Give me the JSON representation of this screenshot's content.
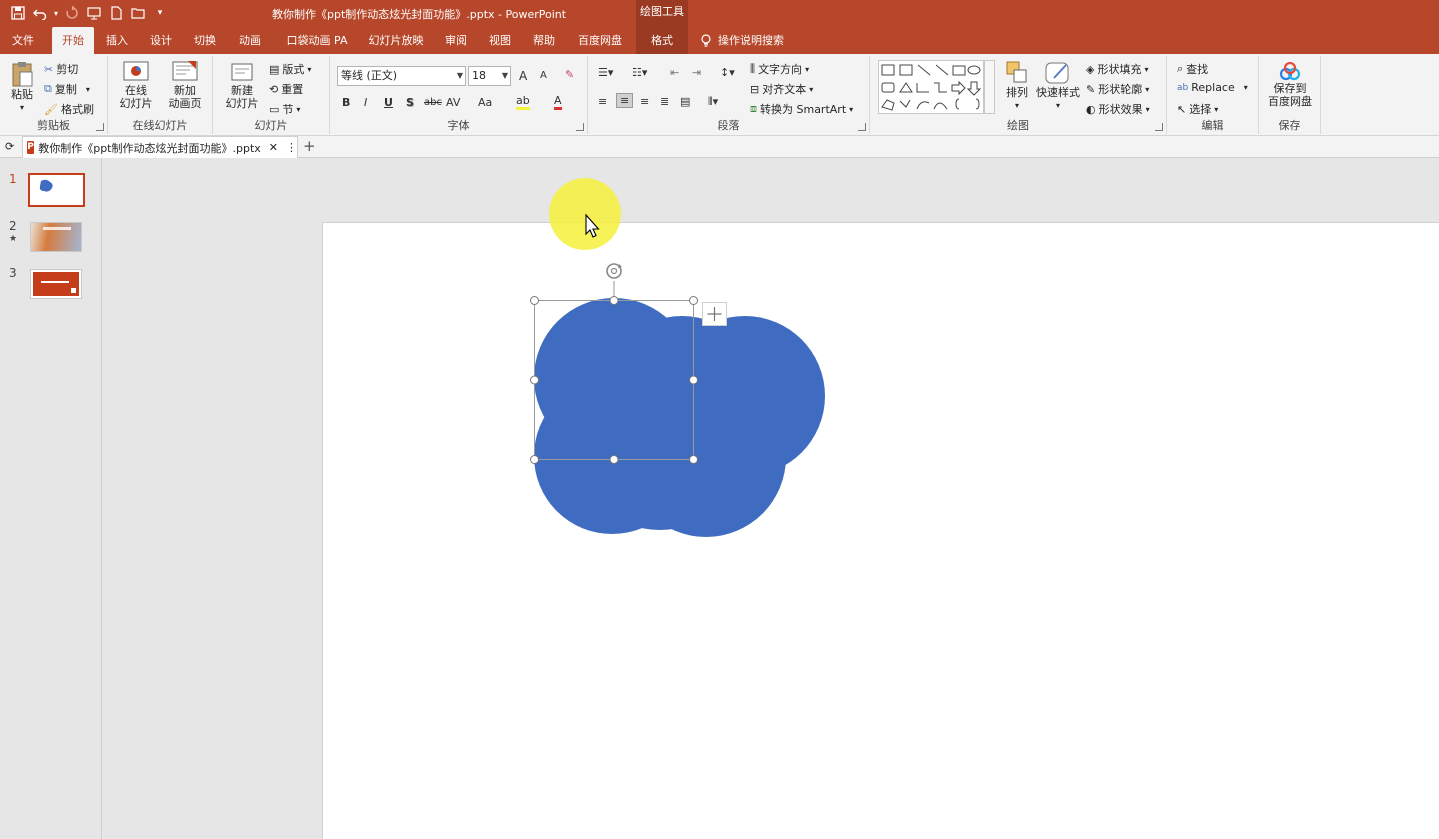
{
  "app": {
    "document_title": "教你制作《ppt制作动态炫光封面功能》.pptx  -  PowerPoint",
    "context_tool_title": "绘图工具"
  },
  "tabs": [
    "文件",
    "开始",
    "插入",
    "设计",
    "切换",
    "动画",
    "口袋动画 PA",
    "幻灯片放映",
    "审阅",
    "视图",
    "帮助",
    "百度网盘",
    "格式"
  ],
  "tell_me": "操作说明搜索",
  "ribbon": {
    "clipboard": {
      "paste": "粘贴",
      "cut": "剪切",
      "copy": "复制",
      "format_painter": "格式刷",
      "label": "剪贴板"
    },
    "online_slides": {
      "online_line1": "在线",
      "online_line2": "幻灯片",
      "new_anim_line1": "新加",
      "new_anim_line2": "动画页",
      "label": "在线幻灯片"
    },
    "slides": {
      "new_slide_line1": "新建",
      "new_slide_line2": "幻灯片",
      "layout": "版式",
      "reset": "重置",
      "section": "节",
      "label": "幻灯片"
    },
    "font": {
      "font_name": "等线 (正文)",
      "font_size": "18",
      "grow": "A",
      "shrink": "A",
      "bold": "B",
      "italic": "I",
      "underline": "U",
      "shadow": "S",
      "strike": "abc",
      "spacing": "AV",
      "case": "Aa",
      "color": "A",
      "label": "字体"
    },
    "paragraph": {
      "text_direction": "文字方向",
      "align_text": "对齐文本",
      "convert_smartart": "转换为 SmartArt",
      "label": "段落"
    },
    "drawing": {
      "arrange": "排列",
      "quick_styles": "快速样式",
      "shape_fill": "形状填充",
      "shape_outline": "形状轮廓",
      "shape_effects": "形状效果",
      "label": "绘图"
    },
    "editing": {
      "find": "查找",
      "replace": "Replace",
      "select": "选择",
      "label": "编辑"
    },
    "save": {
      "line1": "保存到",
      "line2": "百度网盘",
      "label": "保存"
    }
  },
  "doc_tab": {
    "name": "教你制作《ppt制作动态炫光封面功能》.pptx",
    "close": "✕",
    "menu": "⋮",
    "add": "+"
  },
  "thumbnails": [
    {
      "num": "1",
      "star": ""
    },
    {
      "num": "2",
      "star": "★"
    },
    {
      "num": "3",
      "star": ""
    }
  ],
  "colors": {
    "accent": "#b7472a",
    "shape_fill": "#3f6cc1",
    "highlight": "#f5f03a"
  },
  "icons": [
    "save-icon",
    "undo-icon",
    "redo-icon",
    "new-file-icon",
    "open-folder-icon",
    "lightbulb-icon",
    "mouse-cursor-icon",
    "rotate-handle-icon"
  ]
}
